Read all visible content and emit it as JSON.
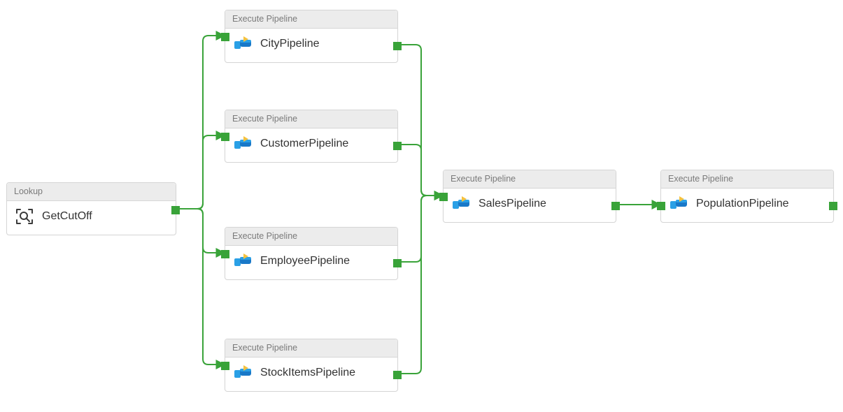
{
  "activityTypes": {
    "lookup": "Lookup",
    "executePipeline": "Execute Pipeline"
  },
  "nodes": {
    "getcutoff": {
      "type": "lookup",
      "name": "GetCutOff"
    },
    "city": {
      "type": "executePipeline",
      "name": "CityPipeline"
    },
    "customer": {
      "type": "executePipeline",
      "name": "CustomerPipeline"
    },
    "employee": {
      "type": "executePipeline",
      "name": "EmployeePipeline"
    },
    "stockitems": {
      "type": "executePipeline",
      "name": "StockItemsPipeline"
    },
    "sales": {
      "type": "executePipeline",
      "name": "SalesPipeline"
    },
    "population": {
      "type": "executePipeline",
      "name": "PopulationPipeline"
    }
  },
  "colors": {
    "connector": "#39a339",
    "nodeBorder": "#d6d6d6",
    "header": "#ececec"
  }
}
